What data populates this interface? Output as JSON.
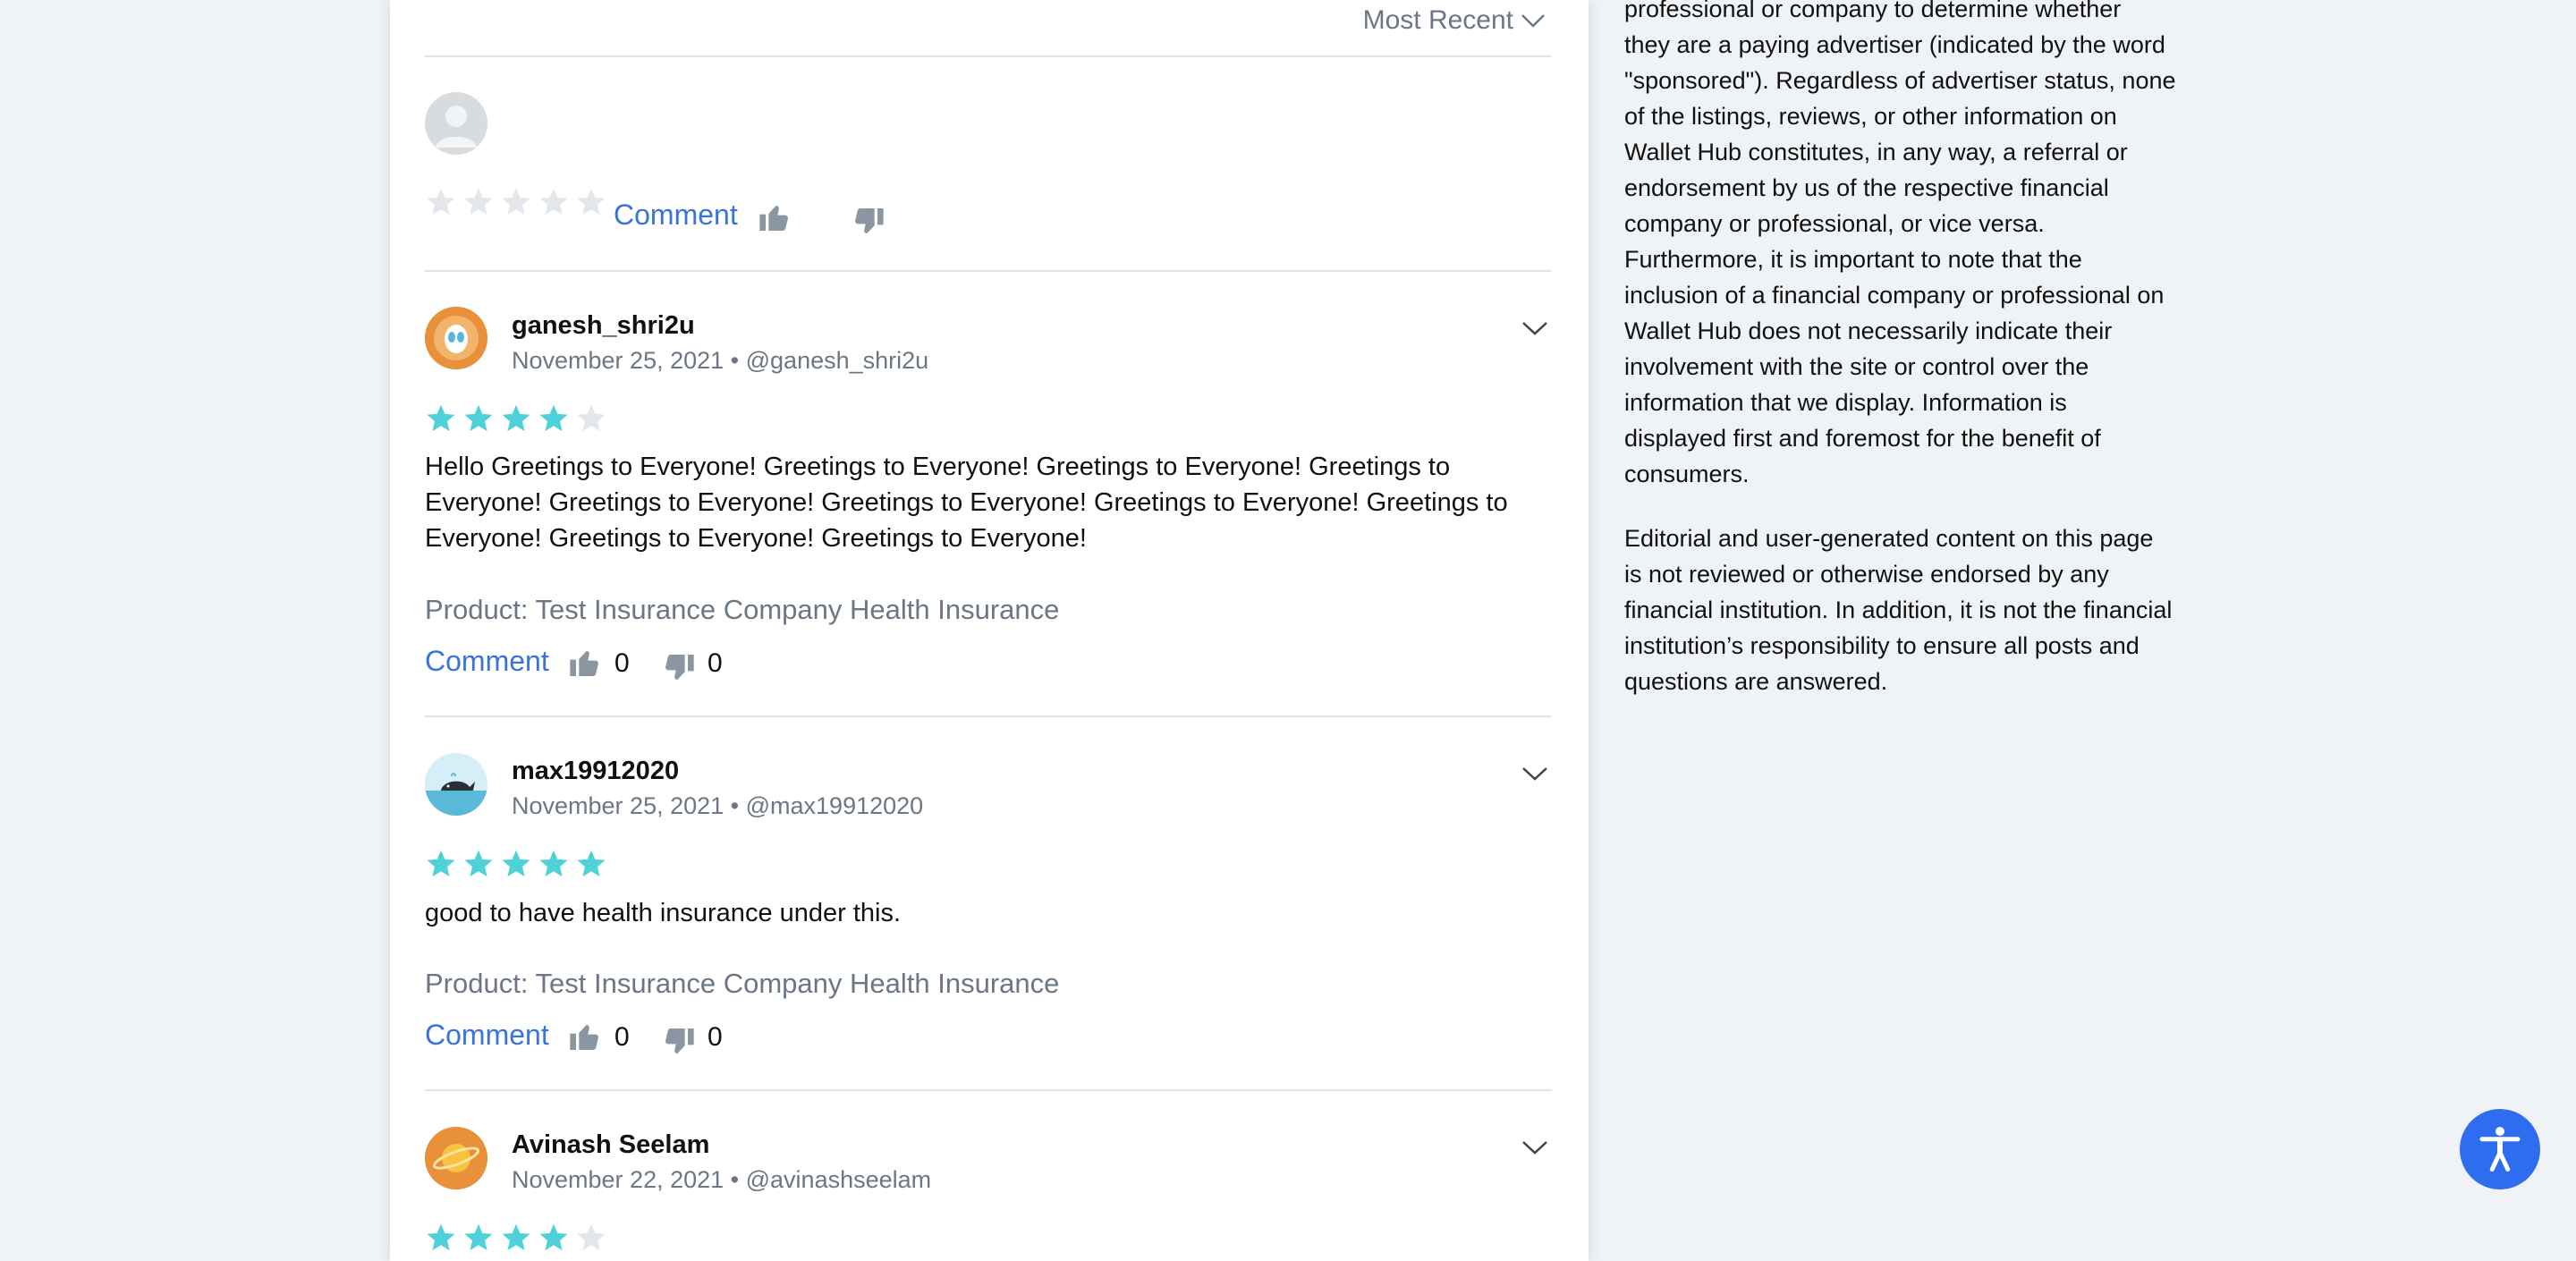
{
  "sort": {
    "label": "Most Recent"
  },
  "new_review": {
    "comment_label": "Comment",
    "rating": 0
  },
  "reviews": [
    {
      "username": "ganesh_shri2u",
      "date": "November 25, 2021",
      "handle": "@ganesh_shri2u",
      "rating": 4,
      "text": "Hello Greetings to Everyone! Greetings to Everyone! Greetings to Everyone! Greetings to Everyone! Greetings to Everyone! Greetings to Everyone! Greetings to Everyone! Greetings to Everyone! Greetings to Everyone! Greetings to Everyone!",
      "product": "Product: Test Insurance Company Health Insurance",
      "comment_label": "Comment",
      "likes": "0",
      "dislikes": "0",
      "avatar_icon": "alien-avatar-icon"
    },
    {
      "username": "max19912020",
      "date": "November 25, 2021",
      "handle": "@max19912020",
      "rating": 5,
      "text": "good to have health insurance under this.",
      "product": "Product: Test Insurance Company Health Insurance",
      "comment_label": "Comment",
      "likes": "0",
      "dislikes": "0",
      "avatar_icon": "whale-avatar-icon"
    },
    {
      "username": "Avinash Seelam",
      "date": "November 22, 2021",
      "handle": "@avinashseelam",
      "rating": 4,
      "avatar_icon": "planet-avatar-icon"
    }
  ],
  "sidebar": {
    "paragraph1_lines": [
      "professional or company to determine whether",
      "they are a paying advertiser (indicated by the word",
      "\"sponsored\"). Regardless of advertiser status, none",
      "of the listings, reviews, or other information on",
      "Wallet Hub constitutes, in any way, a referral or",
      "endorsement by us of the respective financial",
      "company or professional, or vice versa.",
      "Furthermore, it is important to note that the",
      "inclusion of a financial company or professional on",
      "Wallet Hub does not necessarily indicate their",
      "involvement with the site or control over the",
      "information that we display. Information is",
      "displayed first and foremost for the benefit of",
      "consumers."
    ],
    "paragraph2_lines": [
      "Editorial and user-generated content on this page",
      "is not reviewed or otherwise endorsed by any",
      "financial institution. In addition, it is not the financial",
      "institution’s responsibility to ensure all posts and",
      "questions are answered."
    ]
  },
  "colors": {
    "star_filled": "#4fd1d9",
    "star_empty": "#e3e6ea",
    "link": "#3a74d9",
    "accessibility_button": "#2f6df0"
  },
  "accessibility_icon": "accessibility-icon"
}
